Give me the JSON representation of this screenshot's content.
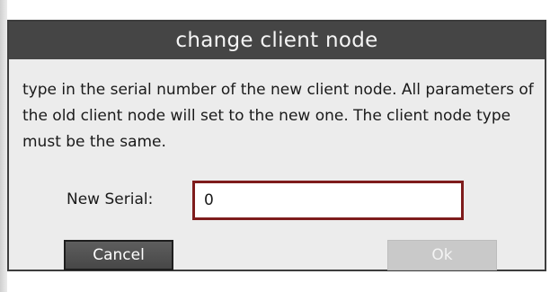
{
  "dialog": {
    "title": "change client node",
    "message": "type in the serial number of the new client node. All parameters of the old client node will set to the new one. The client node type must be the same.",
    "serial_label": "New Serial:",
    "serial_value": "0",
    "cancel_label": "Cancel",
    "ok_label": "Ok",
    "colors": {
      "titlebar": "#454545",
      "body": "#ececec",
      "input_border": "#7e1c1c",
      "cancel_button": "#4f4f4f",
      "ok_button_disabled": "#c9c9c9"
    }
  }
}
